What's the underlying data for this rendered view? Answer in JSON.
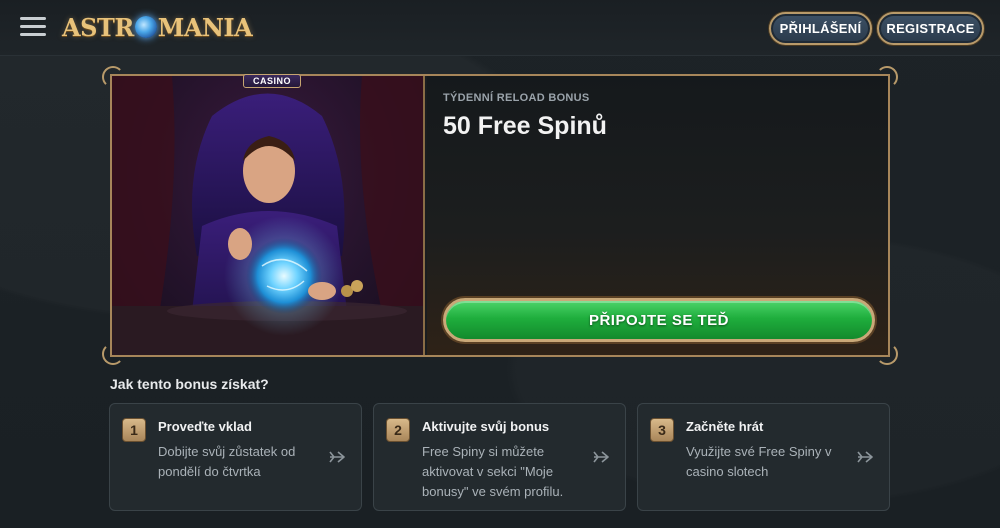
{
  "header": {
    "logo_text_a": "ASTR",
    "logo_text_b": "MANIA",
    "login_label": "PŘIHLÁŠENÍ",
    "register_label": "REGISTRACE"
  },
  "banner": {
    "casino_tag": "CASINO",
    "label": "TÝDENNÍ RELOAD BONUS",
    "title": "50 Free Spinů",
    "cta_label": "PŘIPOJTE SE TEĎ"
  },
  "how": {
    "title": "Jak tento bonus získat?",
    "steps": [
      {
        "num": "1",
        "title": "Proveďte vklad",
        "desc": "Dobijte svůj zůstatek od pondělí do čtvrtka"
      },
      {
        "num": "2",
        "title": "Aktivujte svůj bonus",
        "desc": "Free Spiny si můžete aktivovat v sekci \"Moje bonusy\" ve svém profilu."
      },
      {
        "num": "3",
        "title": "Začněte hrát",
        "desc": "Využijte své Free Spiny v casino slotech"
      }
    ]
  },
  "colors": {
    "accent_gold": "#b89a6a",
    "cta_green": "#1fae3d",
    "background": "#1b2125"
  }
}
